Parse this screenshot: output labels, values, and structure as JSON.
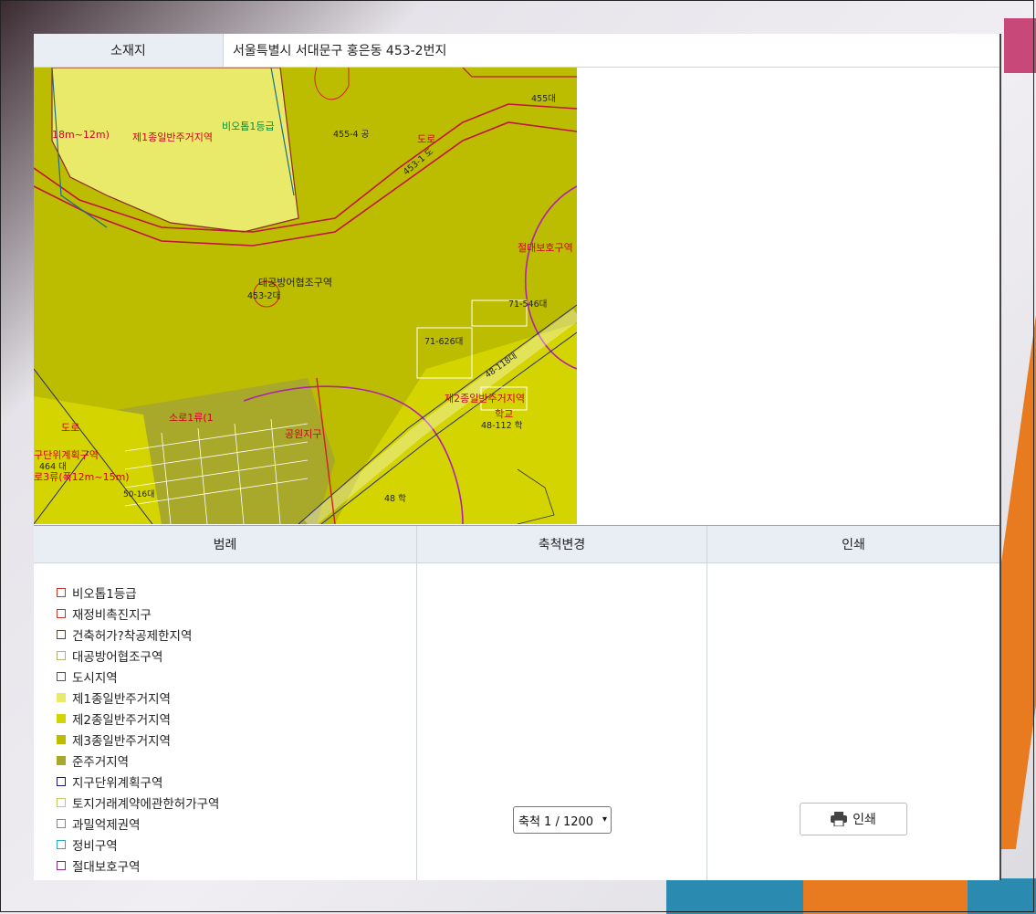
{
  "address": {
    "label": "소재지",
    "value": "서울특별시 서대문구 홍은동 453-2번지"
  },
  "map": {
    "labels": [
      "제1종일반주거지역",
      "비오톱1등급",
      "455-4 공",
      "455대",
      "도로",
      "453-1 도",
      "절대보호구역",
      "대공방어협조구역",
      "453-2대",
      "71-546대",
      "71-626대",
      "48-118대",
      "제2종일반주거지역",
      "학교",
      "48-112 학",
      "소로1류(1",
      "공원지구",
      "464 대",
      "구단위계획구역",
      "로3류(폭12m~15m)",
      "48 학",
      "50-16대",
      "도로",
      "18m~12m)"
    ],
    "zone_colors": {
      "zone1": "#eaea6a",
      "zone2": "#d4d400",
      "zone3": "#bcbc00",
      "semi": "#a8a82a"
    }
  },
  "columns": {
    "legend_header": "범례",
    "scale_header": "축척변경",
    "print_header": "인쇄"
  },
  "legend": [
    {
      "label": "비오톱1등급",
      "border": "#c0392b",
      "fill": "transparent"
    },
    {
      "label": "재정비촉진지구",
      "border": "#c0392b",
      "fill": "transparent"
    },
    {
      "label": "건축허가?착공제한지역",
      "border": "#5a4a3a",
      "fill": "transparent"
    },
    {
      "label": "대공방어협조구역",
      "border": "#b8b070",
      "fill": "transparent"
    },
    {
      "label": "도시지역",
      "border": "#555555",
      "fill": "transparent"
    },
    {
      "label": "제1종일반주거지역",
      "border": "#eaea6a",
      "fill": "#eaea6a"
    },
    {
      "label": "제2종일반주거지역",
      "border": "#d4d400",
      "fill": "#d4d400"
    },
    {
      "label": "제3종일반주거지역",
      "border": "#bcbc00",
      "fill": "#bcbc00"
    },
    {
      "label": "준주거지역",
      "border": "#a8a82a",
      "fill": "#a8a82a"
    },
    {
      "label": "지구단위계획구역",
      "border": "#1a1a6e",
      "fill": "transparent"
    },
    {
      "label": "토지거래계약에관한허가구역",
      "border": "#c8c860",
      "fill": "transparent"
    },
    {
      "label": "과밀억제권역",
      "border": "#888888",
      "fill": "transparent"
    },
    {
      "label": "정비구역",
      "border": "#2aa8c8",
      "fill": "transparent"
    },
    {
      "label": "절대보호구역",
      "border": "#8a2a8a",
      "fill": "transparent"
    }
  ],
  "scale": {
    "selected": "축척 1 / 1200"
  },
  "print": {
    "button_label": "인쇄"
  }
}
